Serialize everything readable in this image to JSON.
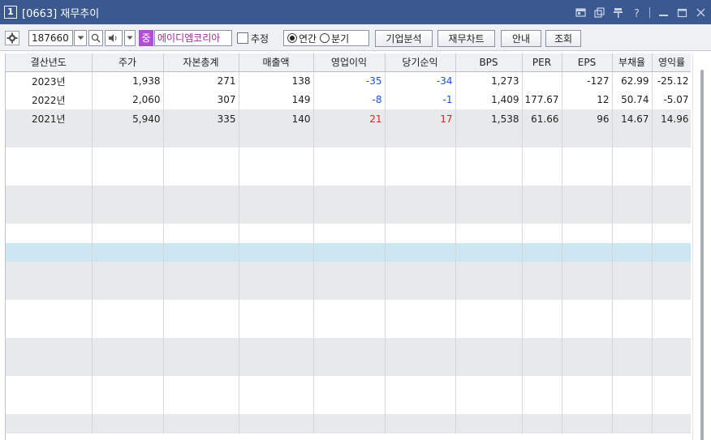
{
  "window": {
    "number": "1",
    "title": "[0663] 재무추이"
  },
  "toolbar": {
    "stock_code": "187660",
    "stock_badge": "중",
    "stock_name": "에이디엠코리아",
    "estimate_label": "추정",
    "annual_label": "연간",
    "quarter_label": "분기",
    "selected_period": "연간",
    "company_analysis_label": "기업분석",
    "finance_chart_label": "재무차트",
    "guide_label": "안내",
    "query_label": "조회"
  },
  "table": {
    "columns": [
      "결산년도",
      "주가",
      "자본총계",
      "매출액",
      "영업이익",
      "당기순익",
      "BPS",
      "PER",
      "EPS",
      "부채율",
      "영익률"
    ],
    "rows": [
      {
        "year": "2023년",
        "price": "1,938",
        "equity": "271",
        "sales": "138",
        "op_profit": "-35",
        "net_profit": "-34",
        "bps": "1,273",
        "per": "",
        "eps": "-127",
        "debt_ratio": "62.99",
        "op_margin": "-25.12"
      },
      {
        "year": "2022년",
        "price": "2,060",
        "equity": "307",
        "sales": "149",
        "op_profit": "-8",
        "net_profit": "-1",
        "bps": "1,409",
        "per": "177.67",
        "eps": "12",
        "debt_ratio": "50.74",
        "op_margin": "-5.07"
      },
      {
        "year": "2021년",
        "price": "5,940",
        "equity": "335",
        "sales": "140",
        "op_profit": "21",
        "net_profit": "17",
        "bps": "1,538",
        "per": "61.66",
        "eps": "96",
        "debt_ratio": "14.67",
        "op_margin": "14.96"
      }
    ]
  },
  "colors": {
    "titlebar": "#3b5890",
    "negative": "#1a4fd8",
    "positive": "#e0201c",
    "selected_row": "#cce6f2",
    "stock_badge": "#b04fd3"
  }
}
